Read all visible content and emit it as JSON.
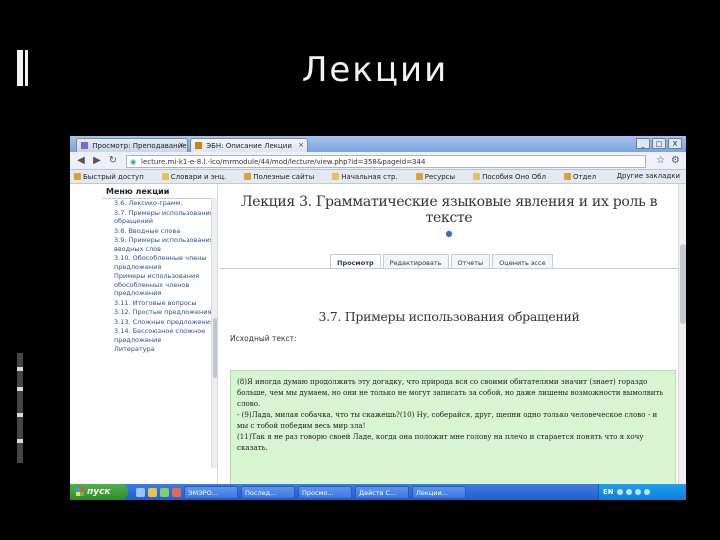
{
  "slide": {
    "title": "Лекции"
  },
  "browser": {
    "tabs": [
      {
        "label": "Просмотр: Преподавание"
      },
      {
        "label": "ЭБН: Описание Лекции"
      }
    ],
    "window_buttons": [
      "_",
      "□",
      "X"
    ],
    "url": "lecture.mi-k1-e-8.l.-lco/mrmodule/44/mod/lecture/view.php?id=358&pageid=344",
    "bookmarks": [
      "Быстрый доступ",
      "Словари и энц.",
      "Полезные сайты",
      "Начальная стр.",
      "Ресурсы",
      "Пособия Оно Обл",
      "Отдел"
    ],
    "bookmarks_right": "Другие закладки"
  },
  "menu": {
    "title": "Меню лекции",
    "items": [
      "3.6. Лексико-грамм.",
      "3.7. Примеры использования обращений",
      "3.8. Вводные слова",
      "3.9. Примеры использования вводных слов",
      "3.10. Обособленные члены предложения",
      "Примеры использования обособленных членов предложения",
      "3.11. Итоговые вопросы",
      "3.12. Простые предложения",
      "3.13. Сложные предложения",
      "3.14. Бессоюзное сложное предложение",
      "Литература"
    ]
  },
  "main": {
    "lecture_title": "Лекция 3. Грамматические языковые явления и их роль в тексте",
    "tabs": [
      "Просмотр",
      "Редактировать",
      "Отчеты",
      "Оценить эссе"
    ],
    "section_title": "3.7. Примеры использования обращений",
    "source_label": "Исходный текст:",
    "source_text": [
      "(8)Я иногда думаю продолжить эту догадку, что природа вся со своими обитателями значит (знает) гораздо больше, чем мы думаем, но они не только не могут записать за собой, но даже лишены возможности вымолвить слово.",
      "- (9)Лада, милая собачка, что ты скажешь?(10) Ну, соберайся, друг, щепни одно только человеческое слово - и мы с тобой победим весь мир зла!",
      "(11)Так я не раз говорю своей Ладе, когда она положит мне голову на плечо и старается понять что я хочу сказать."
    ]
  },
  "taskbar": {
    "start": "пуск",
    "windows": [
      "ЭМЭРО...",
      "Послед...",
      "Просмо...",
      "Действ С...",
      "Лекции..."
    ],
    "lang": "EN"
  }
}
